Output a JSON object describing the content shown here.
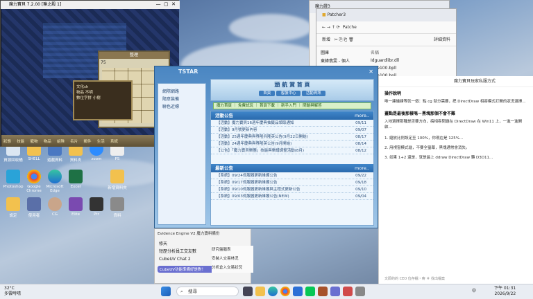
{
  "game": {
    "title": "魔力寶貝 7.2.00 [聯之殿 1]",
    "panel_title": "整理",
    "panel_value": "75",
    "chat_lines": [
      "文化sh",
      "物品 不明",
      "數位字拼 小樹"
    ],
    "menu": [
      "狀態",
      "技能",
      "寵物",
      "物品",
      "組隊",
      "名片",
      "郵件",
      "生活",
      "系統"
    ]
  },
  "explorer_back": {
    "title": "魔力證3"
  },
  "explorer_front": {
    "tab": "Patcher3",
    "address": "Patche",
    "new_label": "新增",
    "view_label": "檢視",
    "sidebar": [
      "圖庫",
      "東緯翡雯 - 個人"
    ],
    "col_name": "名稱",
    "files": [
      "Idguardlibr.dll",
      "inde100.bpll",
      "inde100.bpll"
    ],
    "detail_label": "詳細資料"
  },
  "launcher": {
    "logo_text": "TSTAR",
    "left_items": [
      "網際網路",
      "隨意裝備",
      "聯色近標"
    ],
    "main_title": "頭 航 賞 首 頁",
    "tabs": [
      "首頁",
      "客服中心",
      "活動資訊"
    ],
    "nav": [
      "魔力首頁",
      "免費試玩",
      "首頁下載",
      "新手入門",
      "問題與解答"
    ],
    "nav_prefix": "網際眼閱讀",
    "section1": "活動公告",
    "section2": "最新公告",
    "more": "more..",
    "news1": [
      {
        "t": "【活動】魔力寶貝16週年慶典抽籤品領取通知",
        "d": "09/11"
      },
      {
        "t": "【活動】9月號更新內容",
        "d": "09/07"
      },
      {
        "t": "【活動】25週年慶典與界隆兵隆英公告(9月22日開始)",
        "d": "08/17"
      },
      {
        "t": "【活動】24週年慶典與界隆英公告(9月開始)",
        "d": "08/14"
      },
      {
        "t": "【公告】「魔力寶貝樂團」技能與樂譜調整活動(8月)",
        "d": "08/12"
      }
    ],
    "news2": [
      {
        "t": "【系統】09/24伺服器更新維護公告",
        "d": "09/22"
      },
      {
        "t": "【系統】09/17伺服器更新維護公告",
        "d": "09/18"
      },
      {
        "t": "【系統】09/10伺服器更新維護與主程式更新公告",
        "d": "09/10"
      },
      {
        "t": "【系統】09/03伺服器更新維護公告(NEW)",
        "d": "09/04"
      }
    ]
  },
  "browser": {
    "tab": "魔力寶貝玩家私服方式",
    "heading1": "操作說明",
    "para1": "唯一建議練等就一個：點 cg 部分需要，把 DirectDraw 相容模式打開的狀況選擇...",
    "heading2": "畫點是最後那樣嗎－黑塊那個不會不難",
    "para2": "入地選擇那種是否要方向，搞相容問題在 DirectDraw 在 Win11 上，一進一進開啟...",
    "list1": "1. 縮放比例設定至 100%，你現在是 125%...",
    "list2": "2. 用視窗模式進，不要全螢幕，黑塊通常會消失。",
    "list3": "3. 如果 1+2 還是，就是最上 ddraw DirectDraw 轉 D3D11...",
    "footer": "文即的的 CEO 位存檔・寄 ＃ 找出檔案"
  },
  "sidepanel": {
    "title": "Evidence Engine V2 魔力寶料備份",
    "items": [
      "修天",
      "短歷分析員工交友數",
      "CubeUV Chat 2"
    ],
    "bottom": "CubeUV功能準備好是對！"
  },
  "subpanel": {
    "items": [
      "研究盤腦表",
      "安裝人交易林況",
      "分析倉入交易狀況"
    ]
  },
  "desktop_icons": [
    "資源回收桶",
    "SHELL",
    "遊戲資料",
    "資料夾",
    "zoom",
    "PS",
    "Photoshop",
    "Google Chrome",
    "Microsoft Edge",
    "Excel",
    "新增資料夾",
    "設定",
    "使用者",
    "CG",
    "Elite",
    "Ptr",
    "資料"
  ],
  "taskbar": {
    "weather_temp": "32°C",
    "weather_desc": "多雲時晴",
    "search_placeholder": "搜尋",
    "time": "下午 01:31",
    "date": "2026/9/22",
    "lang": "中"
  }
}
